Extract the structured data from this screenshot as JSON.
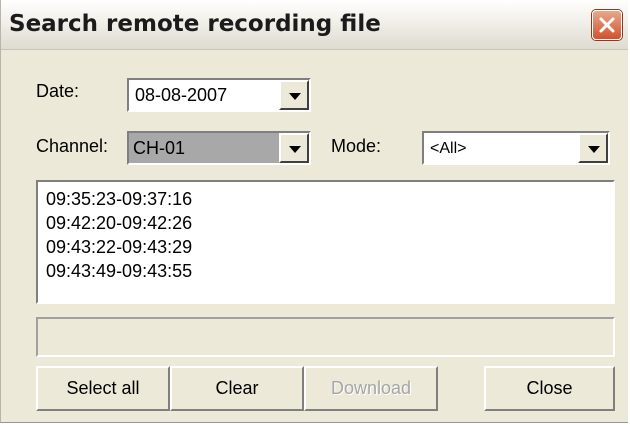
{
  "window": {
    "title": "Search remote recording file",
    "close_icon": "close-icon"
  },
  "form": {
    "date_label": "Date:",
    "date_value": "08-08-2007",
    "channel_label": "Channel:",
    "channel_value": "CH-01",
    "mode_label": "Mode:",
    "mode_value": "<All>"
  },
  "results": [
    "09:35:23-09:37:16",
    "09:42:20-09:42:26",
    "09:43:22-09:43:29",
    "09:43:49-09:43:55"
  ],
  "progress": {
    "value": 0
  },
  "buttons": {
    "select_all": "Select all",
    "clear": "Clear",
    "download": "Download",
    "close": "Close"
  },
  "colors": {
    "dialog_bg": "#ece9d8",
    "close_button": "#d2512e",
    "channel_highlight": "#a8a8a8",
    "disabled_text": "#a6a6a6"
  }
}
